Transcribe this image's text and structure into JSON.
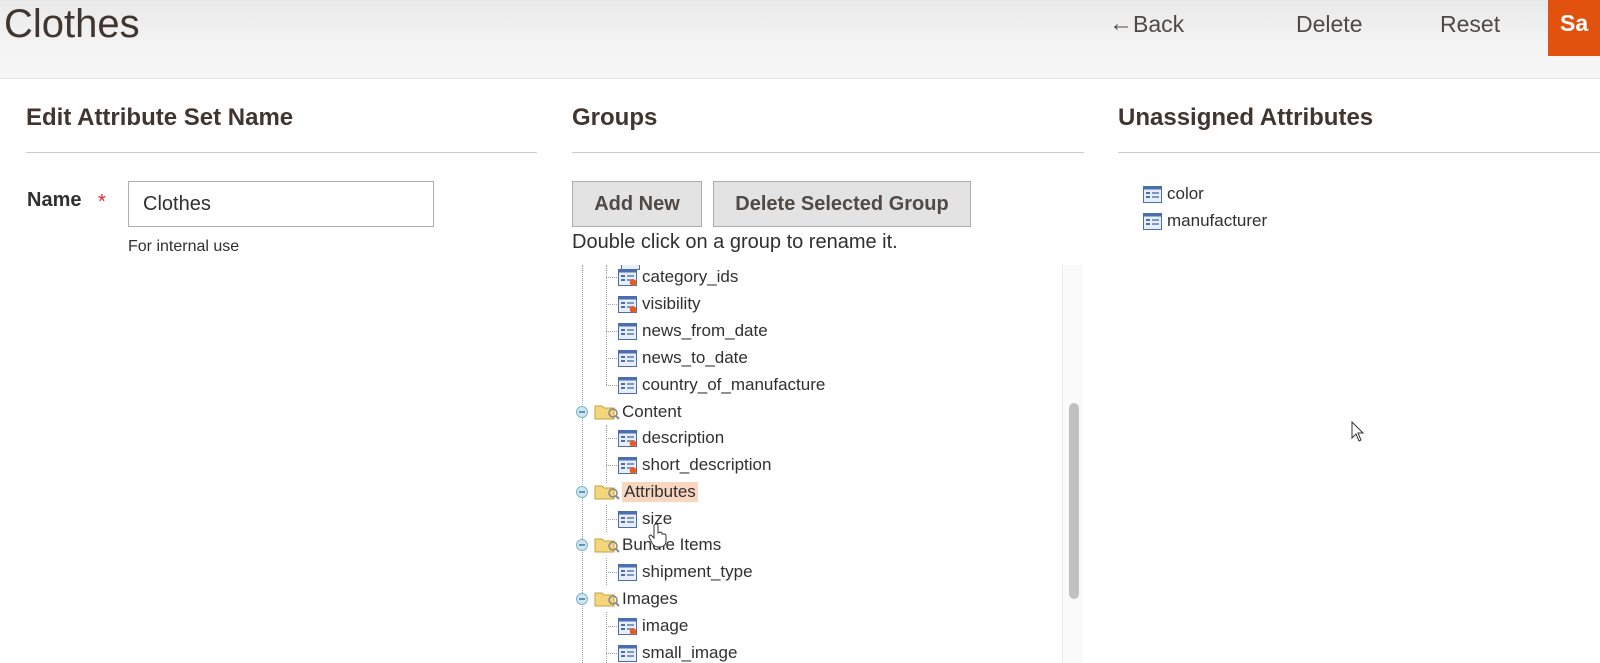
{
  "header": {
    "title": "Clothes",
    "back_label": "Back",
    "delete_label": "Delete",
    "reset_label": "Reset",
    "save_label": "Sa",
    "save_color": "#e1520e"
  },
  "left": {
    "title": "Edit Attribute Set Name",
    "name_label": "Name",
    "required_mark": "*",
    "name_value": "Clothes",
    "name_note": "For internal use"
  },
  "groups": {
    "title": "Groups",
    "add_new_label": "Add New",
    "delete_selected_label": "Delete Selected Group",
    "hint": "Double click on a group to rename it.",
    "tree": [
      {
        "type": "attr",
        "label": "category_ids",
        "system": true
      },
      {
        "type": "attr",
        "label": "visibility",
        "system": true
      },
      {
        "type": "attr",
        "label": "news_from_date",
        "system": false
      },
      {
        "type": "attr",
        "label": "news_to_date",
        "system": false
      },
      {
        "type": "attr",
        "label": "country_of_manufacture",
        "system": false
      },
      {
        "type": "group",
        "label": "Content"
      },
      {
        "type": "attr",
        "label": "description",
        "system": true
      },
      {
        "type": "attr",
        "label": "short_description",
        "system": true
      },
      {
        "type": "group",
        "label": "Attributes",
        "selected": true
      },
      {
        "type": "attr",
        "label": "size",
        "system": false
      },
      {
        "type": "group",
        "label": "Bundle Items"
      },
      {
        "type": "attr",
        "label": "shipment_type",
        "system": false
      },
      {
        "type": "group",
        "label": "Images"
      },
      {
        "type": "attr",
        "label": "image",
        "system": true
      },
      {
        "type": "attr",
        "label": "small_image",
        "system": false
      }
    ]
  },
  "unassigned": {
    "title": "Unassigned Attributes",
    "items": [
      "color",
      "manufacturer"
    ]
  }
}
